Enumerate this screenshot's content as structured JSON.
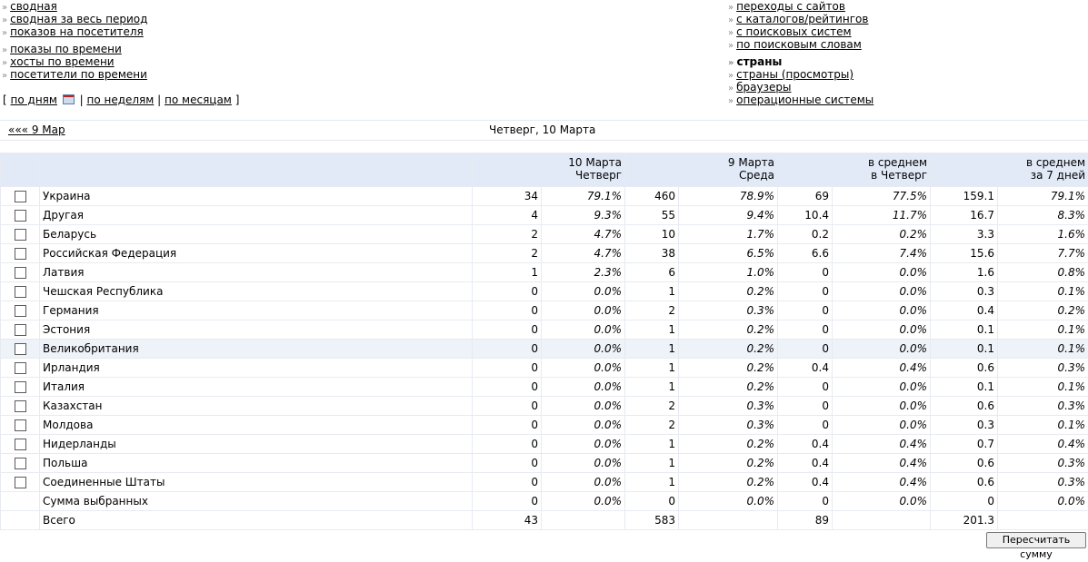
{
  "nav_left": {
    "group1": [
      "сводная",
      "сводная за весь период",
      "показов на посетителя"
    ],
    "group2": [
      "показы по времени",
      "хосты по времени",
      "посетители по времени"
    ]
  },
  "nav_right": {
    "group1": [
      "переходы с сайтов",
      "с каталогов/рейтингов",
      "с поисковых систем",
      "по поисковым словам"
    ],
    "group2_current": "страны",
    "group2": [
      "страны (просмотры)",
      "браузеры",
      "операционные системы"
    ]
  },
  "period": {
    "open_bracket": "[",
    "by_days": "по дням",
    "sep": "|",
    "by_weeks": "по неделям",
    "by_months": "по месяцам",
    "close_bracket": "]"
  },
  "datebar": {
    "prev_link": "««« 9 Мар",
    "current": "Четверг, 10 Марта"
  },
  "table": {
    "headers": [
      {
        "line1": "10 Марта",
        "line2": "Четверг"
      },
      {
        "line1": "9 Марта",
        "line2": "Среда"
      },
      {
        "line1": "в среднем",
        "line2": "в Четверг"
      },
      {
        "line1": "в среднем",
        "line2": "за 7 дней"
      }
    ],
    "rows": [
      {
        "country": "Украина",
        "v": [
          "34",
          "79.1%",
          "460",
          "78.9%",
          "69",
          "77.5%",
          "159.1",
          "79.1%"
        ]
      },
      {
        "country": "Другая",
        "v": [
          "4",
          "9.3%",
          "55",
          "9.4%",
          "10.4",
          "11.7%",
          "16.7",
          "8.3%"
        ]
      },
      {
        "country": "Беларусь",
        "v": [
          "2",
          "4.7%",
          "10",
          "1.7%",
          "0.2",
          "0.2%",
          "3.3",
          "1.6%"
        ]
      },
      {
        "country": "Российская Федерация",
        "v": [
          "2",
          "4.7%",
          "38",
          "6.5%",
          "6.6",
          "7.4%",
          "15.6",
          "7.7%"
        ]
      },
      {
        "country": "Латвия",
        "v": [
          "1",
          "2.3%",
          "6",
          "1.0%",
          "0",
          "0.0%",
          "1.6",
          "0.8%"
        ]
      },
      {
        "country": "Чешская Республика",
        "v": [
          "0",
          "0.0%",
          "1",
          "0.2%",
          "0",
          "0.0%",
          "0.3",
          "0.1%"
        ]
      },
      {
        "country": "Германия",
        "v": [
          "0",
          "0.0%",
          "2",
          "0.3%",
          "0",
          "0.0%",
          "0.4",
          "0.2%"
        ]
      },
      {
        "country": "Эстония",
        "v": [
          "0",
          "0.0%",
          "1",
          "0.2%",
          "0",
          "0.0%",
          "0.1",
          "0.1%"
        ]
      },
      {
        "country": "Великобритания",
        "v": [
          "0",
          "0.0%",
          "1",
          "0.2%",
          "0",
          "0.0%",
          "0.1",
          "0.1%"
        ]
      },
      {
        "country": "Ирландия",
        "v": [
          "0",
          "0.0%",
          "1",
          "0.2%",
          "0.4",
          "0.4%",
          "0.6",
          "0.3%"
        ]
      },
      {
        "country": "Италия",
        "v": [
          "0",
          "0.0%",
          "1",
          "0.2%",
          "0",
          "0.0%",
          "0.1",
          "0.1%"
        ]
      },
      {
        "country": "Казахстан",
        "v": [
          "0",
          "0.0%",
          "2",
          "0.3%",
          "0",
          "0.0%",
          "0.6",
          "0.3%"
        ]
      },
      {
        "country": "Молдова",
        "v": [
          "0",
          "0.0%",
          "2",
          "0.3%",
          "0",
          "0.0%",
          "0.3",
          "0.1%"
        ]
      },
      {
        "country": "Нидерланды",
        "v": [
          "0",
          "0.0%",
          "1",
          "0.2%",
          "0.4",
          "0.4%",
          "0.7",
          "0.4%"
        ]
      },
      {
        "country": "Польша",
        "v": [
          "0",
          "0.0%",
          "1",
          "0.2%",
          "0.4",
          "0.4%",
          "0.6",
          "0.3%"
        ]
      },
      {
        "country": "Соединенные Штаты",
        "v": [
          "0",
          "0.0%",
          "1",
          "0.2%",
          "0.4",
          "0.4%",
          "0.6",
          "0.3%"
        ]
      }
    ],
    "highlighted_row": "Великобритания",
    "selected_sum": {
      "label": "Сумма выбранных",
      "v": [
        "0",
        "0.0%",
        "0",
        "0.0%",
        "0",
        "0.0%",
        "0",
        "0.0%"
      ]
    },
    "total": {
      "label": "Всего",
      "v": [
        "43",
        "",
        "583",
        "",
        "89",
        "",
        "201.3",
        ""
      ]
    }
  },
  "recalc_button": "Пересчитать сумму"
}
